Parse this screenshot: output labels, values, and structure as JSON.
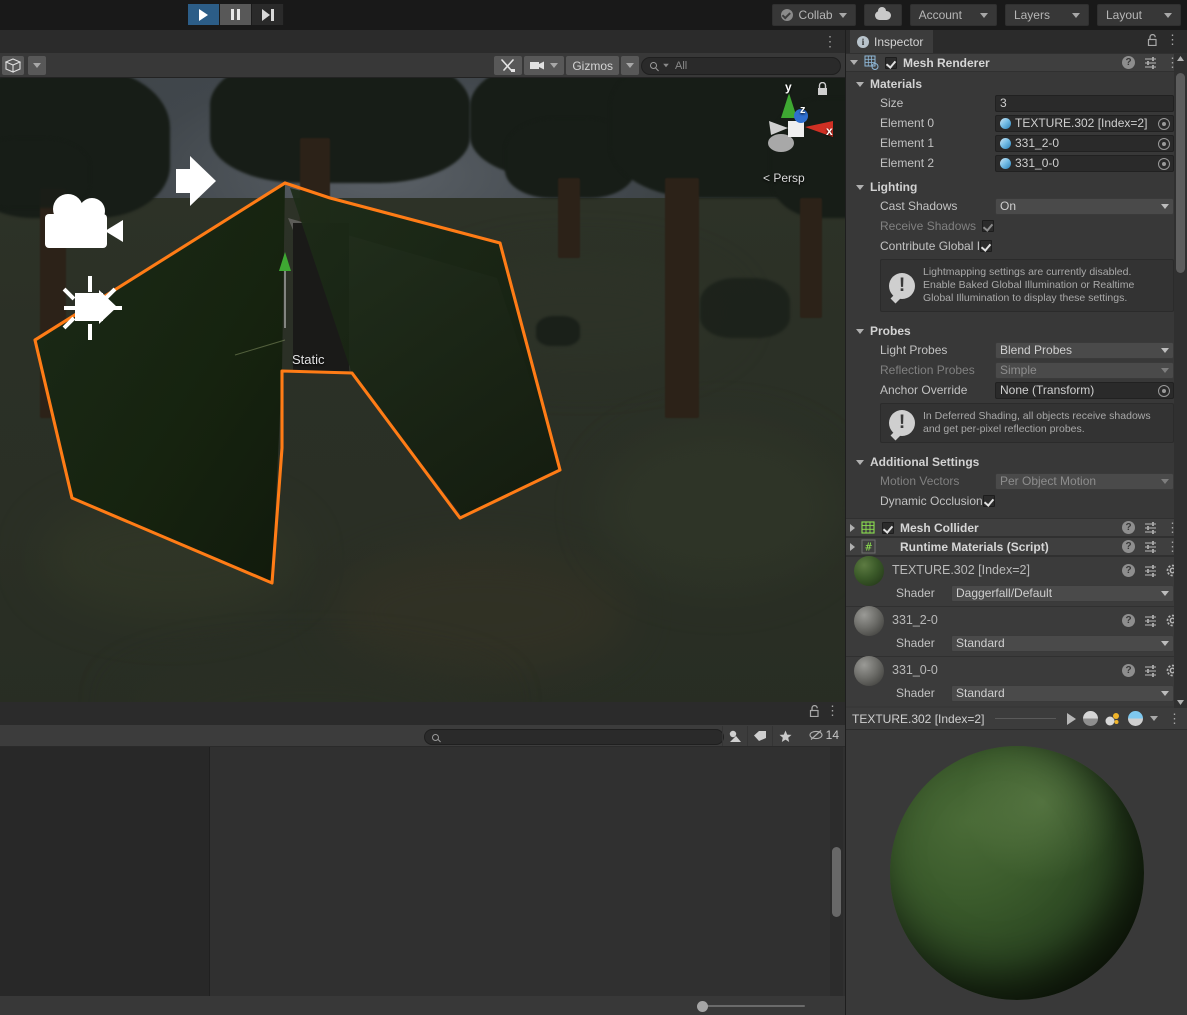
{
  "toolbar": {
    "play_label": "play-button",
    "pause_label": "pause-button",
    "step_label": "step-button",
    "collab": "Collab",
    "cloud": "cloud-button",
    "account": "Account",
    "layers": "Layers",
    "layout": "Layout"
  },
  "scene": {
    "tab": "",
    "gizmos_label": "Gizmos",
    "search_placeholder": "All",
    "persp_label": "Persp",
    "static_label": "Static",
    "axis_x": "x",
    "axis_y": "y",
    "axis_z": "z",
    "outline_color": "#ff7c16"
  },
  "project": {
    "search_placeholder": "",
    "asset_count": "14"
  },
  "inspector": {
    "tab_label": "Inspector",
    "component": {
      "title": "Mesh Renderer",
      "enabled": true
    },
    "sections": {
      "materials": {
        "title": "Materials",
        "size_label": "Size",
        "size_value": "3",
        "elements": [
          {
            "label": "Element 0",
            "value": "TEXTURE.302 [Index=2]"
          },
          {
            "label": "Element 1",
            "value": "331_2-0"
          },
          {
            "label": "Element 2",
            "value": "331_0-0"
          }
        ]
      },
      "lighting": {
        "title": "Lighting",
        "cast_shadows_label": "Cast Shadows",
        "cast_shadows_value": "On",
        "receive_shadows_label": "Receive Shadows",
        "contribute_gi_label": "Contribute Global I",
        "helpbox": "Lightmapping settings are currently disabled. Enable Baked Global Illumination or Realtime Global Illumination to display these settings."
      },
      "probes": {
        "title": "Probes",
        "light_probes_label": "Light Probes",
        "light_probes_value": "Blend Probes",
        "reflection_probes_label": "Reflection Probes",
        "reflection_probes_value": "Simple",
        "anchor_override_label": "Anchor Override",
        "anchor_override_value": "None (Transform)",
        "helpbox": "In Deferred Shading, all objects receive shadows and get per-pixel reflection probes."
      },
      "additional": {
        "title": "Additional Settings",
        "motion_vectors_label": "Motion Vectors",
        "motion_vectors_value": "Per Object Motion",
        "dynamic_occlusion_label": "Dynamic Occlusion"
      }
    },
    "other_components": [
      {
        "title": "Mesh Collider",
        "enabled": true,
        "has_checkbox": true
      },
      {
        "title": "Runtime Materials (Script)",
        "enabled": false,
        "has_checkbox": false
      }
    ],
    "materials": [
      {
        "name": "TEXTURE.302 [Index=2]",
        "shader_label": "Shader",
        "shader": "Daggerfall/Default",
        "color": "#3d5a2c"
      },
      {
        "name": "331_2-0",
        "shader_label": "Shader",
        "shader": "Standard",
        "color": "#6d6d6d"
      },
      {
        "name": "331_0-0",
        "shader_label": "Shader",
        "shader": "Standard",
        "color": "#6d6d6d"
      }
    ]
  },
  "preview": {
    "title": "TEXTURE.302 [Index=2]",
    "sphere_color": "#2f4a26"
  }
}
